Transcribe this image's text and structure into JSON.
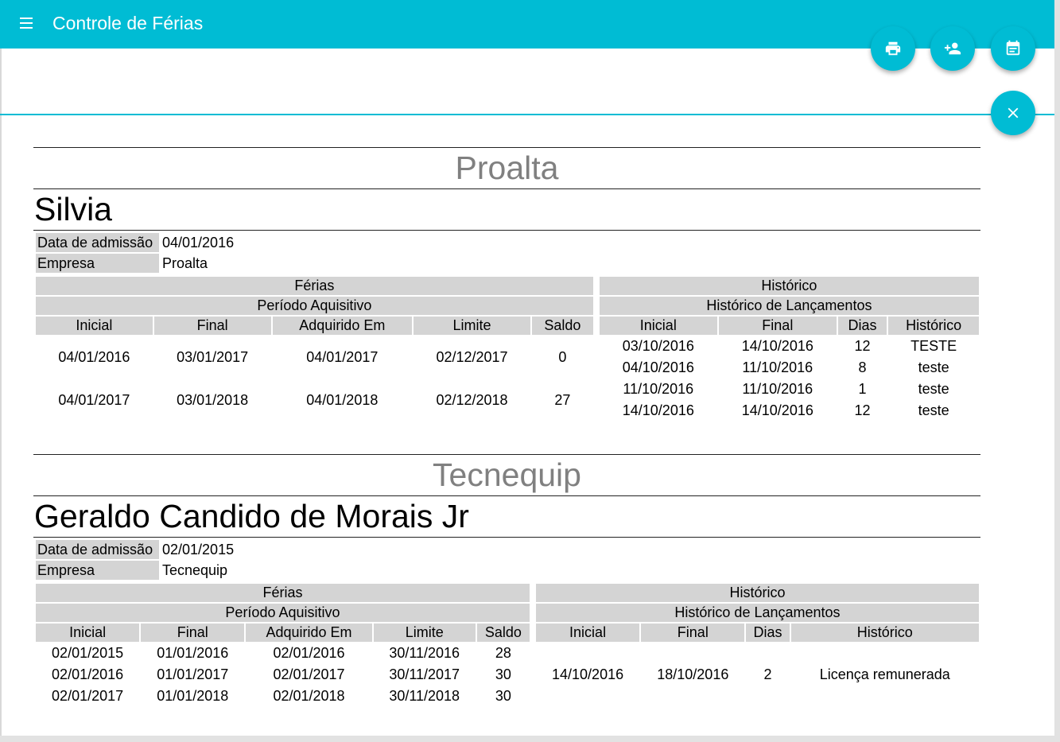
{
  "app": {
    "title": "Controle de Férias"
  },
  "fabs": [
    {
      "name": "print-button",
      "icon": "print-icon"
    },
    {
      "name": "add-person-button",
      "icon": "person-add-icon"
    },
    {
      "name": "calendar-button",
      "icon": "calendar-icon"
    },
    {
      "name": "close-button",
      "icon": "close-icon"
    }
  ],
  "labels": {
    "admission": "Data de admissão",
    "company": "Empresa",
    "ferias": "Férias",
    "periodo": "Período Aquisitivo",
    "historico": "Histórico",
    "historico_lanc": "Histórico de Lançamentos",
    "ferias_cols": [
      "Inicial",
      "Final",
      "Adquirido Em",
      "Limite",
      "Saldo"
    ],
    "hist_cols": [
      "Inicial",
      "Final",
      "Dias",
      "Histórico"
    ]
  },
  "groups": [
    {
      "company": "Proalta",
      "employee": {
        "name": "Silvia",
        "admission": "04/01/2016",
        "company": "Proalta",
        "ferias": [
          [
            "04/01/2016",
            "03/01/2017",
            "04/01/2017",
            "02/12/2017",
            "0"
          ],
          [
            "04/01/2017",
            "03/01/2018",
            "04/01/2018",
            "02/12/2018",
            "27"
          ]
        ],
        "historico": [
          [
            "03/10/2016",
            "14/10/2016",
            "12",
            "TESTE"
          ],
          [
            "04/10/2016",
            "11/10/2016",
            "8",
            "teste"
          ],
          [
            "11/10/2016",
            "11/10/2016",
            "1",
            "teste"
          ],
          [
            "14/10/2016",
            "14/10/2016",
            "12",
            "teste"
          ]
        ]
      }
    },
    {
      "company": "Tecnequip",
      "employee": {
        "name": "Geraldo Candido de Morais Jr",
        "admission": "02/01/2015",
        "company": "Tecnequip",
        "ferias": [
          [
            "02/01/2015",
            "01/01/2016",
            "02/01/2016",
            "30/11/2016",
            "28"
          ],
          [
            "02/01/2016",
            "01/01/2017",
            "02/01/2017",
            "30/11/2017",
            "30"
          ],
          [
            "02/01/2017",
            "01/01/2018",
            "02/01/2018",
            "30/11/2018",
            "30"
          ]
        ],
        "historico": [
          [
            "14/10/2016",
            "18/10/2016",
            "2",
            "Licença remunerada"
          ]
        ]
      }
    }
  ]
}
